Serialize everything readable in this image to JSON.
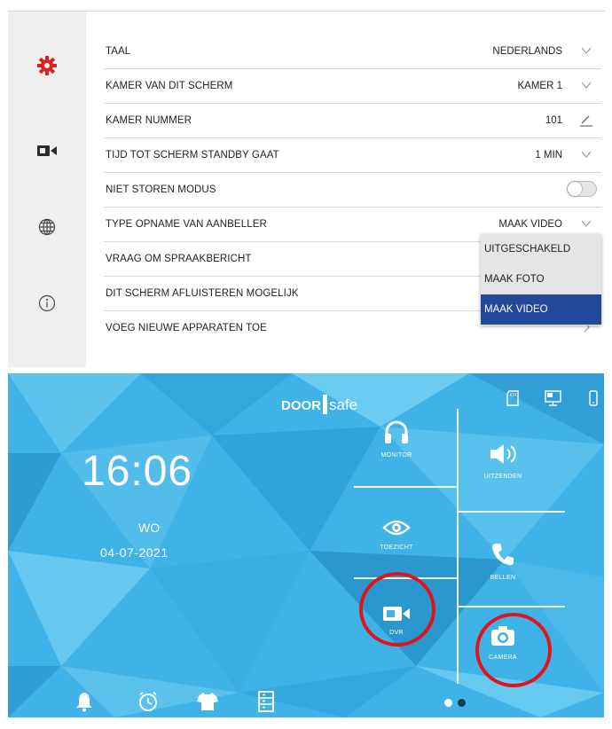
{
  "settings": {
    "sidebar": [
      {
        "icon": "gear-icon",
        "active": true
      },
      {
        "icon": "camera-icon",
        "active": false
      },
      {
        "icon": "globe-icon",
        "active": false
      },
      {
        "icon": "info-icon",
        "active": false
      }
    ],
    "rows": [
      {
        "label": "TAAL",
        "value": "NEDERLANDS",
        "control": "chevron"
      },
      {
        "label": "KAMER VAN DIT SCHERM",
        "value": "KAMER 1",
        "control": "chevron"
      },
      {
        "label": "KAMER NUMMER",
        "value": "101",
        "control": "edit"
      },
      {
        "label": "TIJD TOT SCHERM STANDBY GAAT",
        "value": "1 MIN",
        "control": "chevron"
      },
      {
        "label": "NIET STOREN MODUS",
        "value": "",
        "control": "toggle"
      },
      {
        "label": "TYPE OPNAME VAN AANBELLER",
        "value": "MAAK VIDEO",
        "control": "chevron"
      },
      {
        "label": "VRAAG OM SPRAAKBERICHT",
        "value": "",
        "control": "none"
      },
      {
        "label": "DIT SCHERM AFLUISTEREN MOGELIJK",
        "value": "",
        "control": "none"
      },
      {
        "label": "VOEG NIEUWE APPARATEN TOE",
        "value": "",
        "control": "arrow"
      }
    ],
    "toggle_on": false,
    "dropdown": {
      "options": [
        "UITGESCHAKELD",
        "MAAK FOTO",
        "MAAK VIDEO"
      ],
      "selected": "MAAK VIDEO"
    },
    "colors": {
      "accent": "#d9231f",
      "selected": "#23479a",
      "sidebar_bg": "#efefef"
    }
  },
  "home": {
    "logo": {
      "left": "DOOR",
      "right": "safe"
    },
    "time": "16:06",
    "day": "WO",
    "date": "04-07-2021",
    "tiles": [
      {
        "id": "monitor",
        "label": "MONITOR",
        "icon": "headphones-icon"
      },
      {
        "id": "uitzenden",
        "label": "UITZENDEN",
        "icon": "speaker-icon"
      },
      {
        "id": "toezicht",
        "label": "TOEZICHT",
        "icon": "eye-icon"
      },
      {
        "id": "bellen",
        "label": "BELLEN",
        "icon": "phone-icon"
      },
      {
        "id": "dvr",
        "label": "DVR",
        "icon": "video-camera-icon"
      },
      {
        "id": "camera",
        "label": "CAMERA",
        "icon": "photo-camera-icon"
      }
    ],
    "status_icons": [
      "sd-card-icon",
      "monitor-icon",
      "mobile-icon"
    ],
    "bottom_icons": [
      "bell-icon",
      "alarm-clock-icon",
      "shirt-icon",
      "list-icon"
    ],
    "page_dots": {
      "count": 2,
      "active": 1
    },
    "highlighted": [
      "DVR",
      "CAMERA"
    ],
    "colors": {
      "background": "#3fb3e8",
      "highlight_ring": "#e0141b"
    }
  }
}
